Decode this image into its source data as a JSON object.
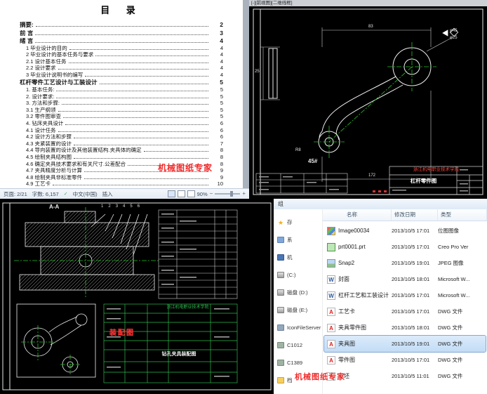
{
  "watermark": {
    "text": "机械图纸专家"
  },
  "word_doc": {
    "title": "目  录",
    "toc": [
      {
        "label": "摘要:",
        "page": "2",
        "bold": true,
        "indent": 0
      },
      {
        "label": "前 言",
        "page": "3",
        "bold": true,
        "indent": 0
      },
      {
        "label": "绪 言",
        "page": "4",
        "bold": true,
        "indent": 0
      },
      {
        "label": "1 毕业设计的目的",
        "page": "4",
        "bold": false,
        "indent": 1
      },
      {
        "label": "2 毕业设计的基本任务与要求",
        "page": "4",
        "bold": false,
        "indent": 1
      },
      {
        "label": "2.1 设计基本任务",
        "page": "4",
        "bold": false,
        "indent": 1
      },
      {
        "label": "2.2 设计要求",
        "page": "4",
        "bold": false,
        "indent": 1
      },
      {
        "label": "3 毕业设计说明书的编写",
        "page": "4",
        "bold": false,
        "indent": 1
      },
      {
        "label": "杠杆零件工艺设计与工装设计",
        "page": "5",
        "bold": true,
        "indent": 0
      },
      {
        "label": "1. 基本任务:",
        "page": "5",
        "bold": false,
        "indent": 1
      },
      {
        "label": "2. 设计要求:",
        "page": "5",
        "bold": false,
        "indent": 1
      },
      {
        "label": "3. 方法和步骤:",
        "page": "5",
        "bold": false,
        "indent": 1
      },
      {
        "label": "3.1 生产纲领",
        "page": "5",
        "bold": false,
        "indent": 1
      },
      {
        "label": "3.2 零件图审查",
        "page": "5",
        "bold": false,
        "indent": 1
      },
      {
        "label": "4. 钻床夹具设计",
        "page": "6",
        "bold": false,
        "indent": 1
      },
      {
        "label": "4.1 设计任务",
        "page": "6",
        "bold": false,
        "indent": 1
      },
      {
        "label": "4.2 设计方法和步骤",
        "page": "6",
        "bold": false,
        "indent": 1
      },
      {
        "label": "4.3 夹紧装置的设计",
        "page": "7",
        "bold": false,
        "indent": 1
      },
      {
        "label": "4.4 导向装置的设计及其他装置结构.夹具体的确定",
        "page": "8",
        "bold": false,
        "indent": 1
      },
      {
        "label": "4.5 绘制夹具结构图",
        "page": "8",
        "bold": false,
        "indent": 1
      },
      {
        "label": "4.6 确定夹具技术要求和有关尺寸.公差配合",
        "page": "8",
        "bold": false,
        "indent": 1
      },
      {
        "label": "4.7 夹具精度分析与计算",
        "page": "9",
        "bold": false,
        "indent": 1
      },
      {
        "label": "4.8 绘制夹具非标准零件",
        "page": "9",
        "bold": false,
        "indent": 1
      },
      {
        "label": "4.9 工艺卡",
        "page": "10",
        "bold": false,
        "indent": 1
      }
    ],
    "status_bar": {
      "page": "页面: 2/21",
      "words": "字数: 6,157",
      "language": "中文(中国)",
      "mode": "插入",
      "zoom": "90%"
    }
  },
  "cad_part": {
    "viewport_label": "[-][前视图][二维线框]",
    "material_label": "45#",
    "dims": {
      "arm_width": "83",
      "thickness": "25",
      "boss_outer": "φ45",
      "boss_hole": "φ25",
      "foot_radius": "R8",
      "length": "172"
    },
    "title_block": {
      "school": "浙江机电职业技术学院",
      "drawing_title": "杠杆零件图"
    }
  },
  "cad_assembly": {
    "section_label": "A-A",
    "balloons": [
      "1",
      "2",
      "3",
      "4",
      "5",
      "6"
    ],
    "stamp": "装配图",
    "title_block": {
      "school": "浙江机电职业技术学院",
      "drawing_title": "钻孔夹具装配图"
    }
  },
  "explorer": {
    "toolbar_fragment": "组",
    "columns": [
      {
        "label": "名称"
      },
      {
        "label": "修改日期"
      },
      {
        "label": "类型"
      }
    ],
    "nav_items": [
      {
        "label": "存",
        "icon": "star-icon"
      },
      {
        "label": "系",
        "icon": "library-icon"
      },
      {
        "label": "机",
        "icon": "computer-icon"
      },
      {
        "label": "(C:)",
        "icon": "disk-icon"
      },
      {
        "label": "磁盘 (D:)",
        "icon": "disk-icon"
      },
      {
        "label": "磁盘 (E:)",
        "icon": "disk-icon"
      },
      {
        "label": "IconFileServer",
        "icon": "server-icon"
      },
      {
        "label": "C1012",
        "icon": "share-icon"
      },
      {
        "label": "C1389",
        "icon": "share-icon"
      },
      {
        "label": "档",
        "icon": "folder-icon"
      }
    ],
    "files": [
      {
        "name": "Image00034",
        "date": "2013/10/5 17:01",
        "type": "位图图像",
        "icon": "bitmap-image-icon",
        "selected": false
      },
      {
        "name": "prt0001.prt",
        "date": "2013/10/5 17:01",
        "type": "Creo Pro Ver",
        "icon": "creo-part-icon",
        "selected": false
      },
      {
        "name": "Snap2",
        "date": "2013/10/5 19:01",
        "type": "JPEG 图像",
        "icon": "jpeg-image-icon",
        "selected": false
      },
      {
        "name": "封面",
        "date": "2013/10/5 18:01",
        "type": "Microsoft W...",
        "icon": "word-document-icon",
        "selected": false
      },
      {
        "name": "杠杆工艺和工装设计",
        "date": "2013/10/5 17:01",
        "type": "Microsoft W...",
        "icon": "word-document-icon",
        "selected": false
      },
      {
        "name": "工艺卡",
        "date": "2013/10/5 17:01",
        "type": "DWG 文件",
        "icon": "dwg-file-icon",
        "selected": false
      },
      {
        "name": "夹具零件图",
        "date": "2013/10/5 18:01",
        "type": "DWG 文件",
        "icon": "dwg-file-icon",
        "selected": false
      },
      {
        "name": "夹具图",
        "date": "2013/10/5 19:01",
        "type": "DWG 文件",
        "icon": "dwg-file-icon",
        "selected": true
      },
      {
        "name": "零件图",
        "date": "2013/10/5 17:01",
        "type": "DWG 文件",
        "icon": "dwg-file-icon",
        "selected": false
      },
      {
        "name": "毛坯",
        "date": "2013/10/5 11:01",
        "type": "DWG 文件",
        "icon": "dwg-file-icon",
        "selected": false
      }
    ]
  }
}
